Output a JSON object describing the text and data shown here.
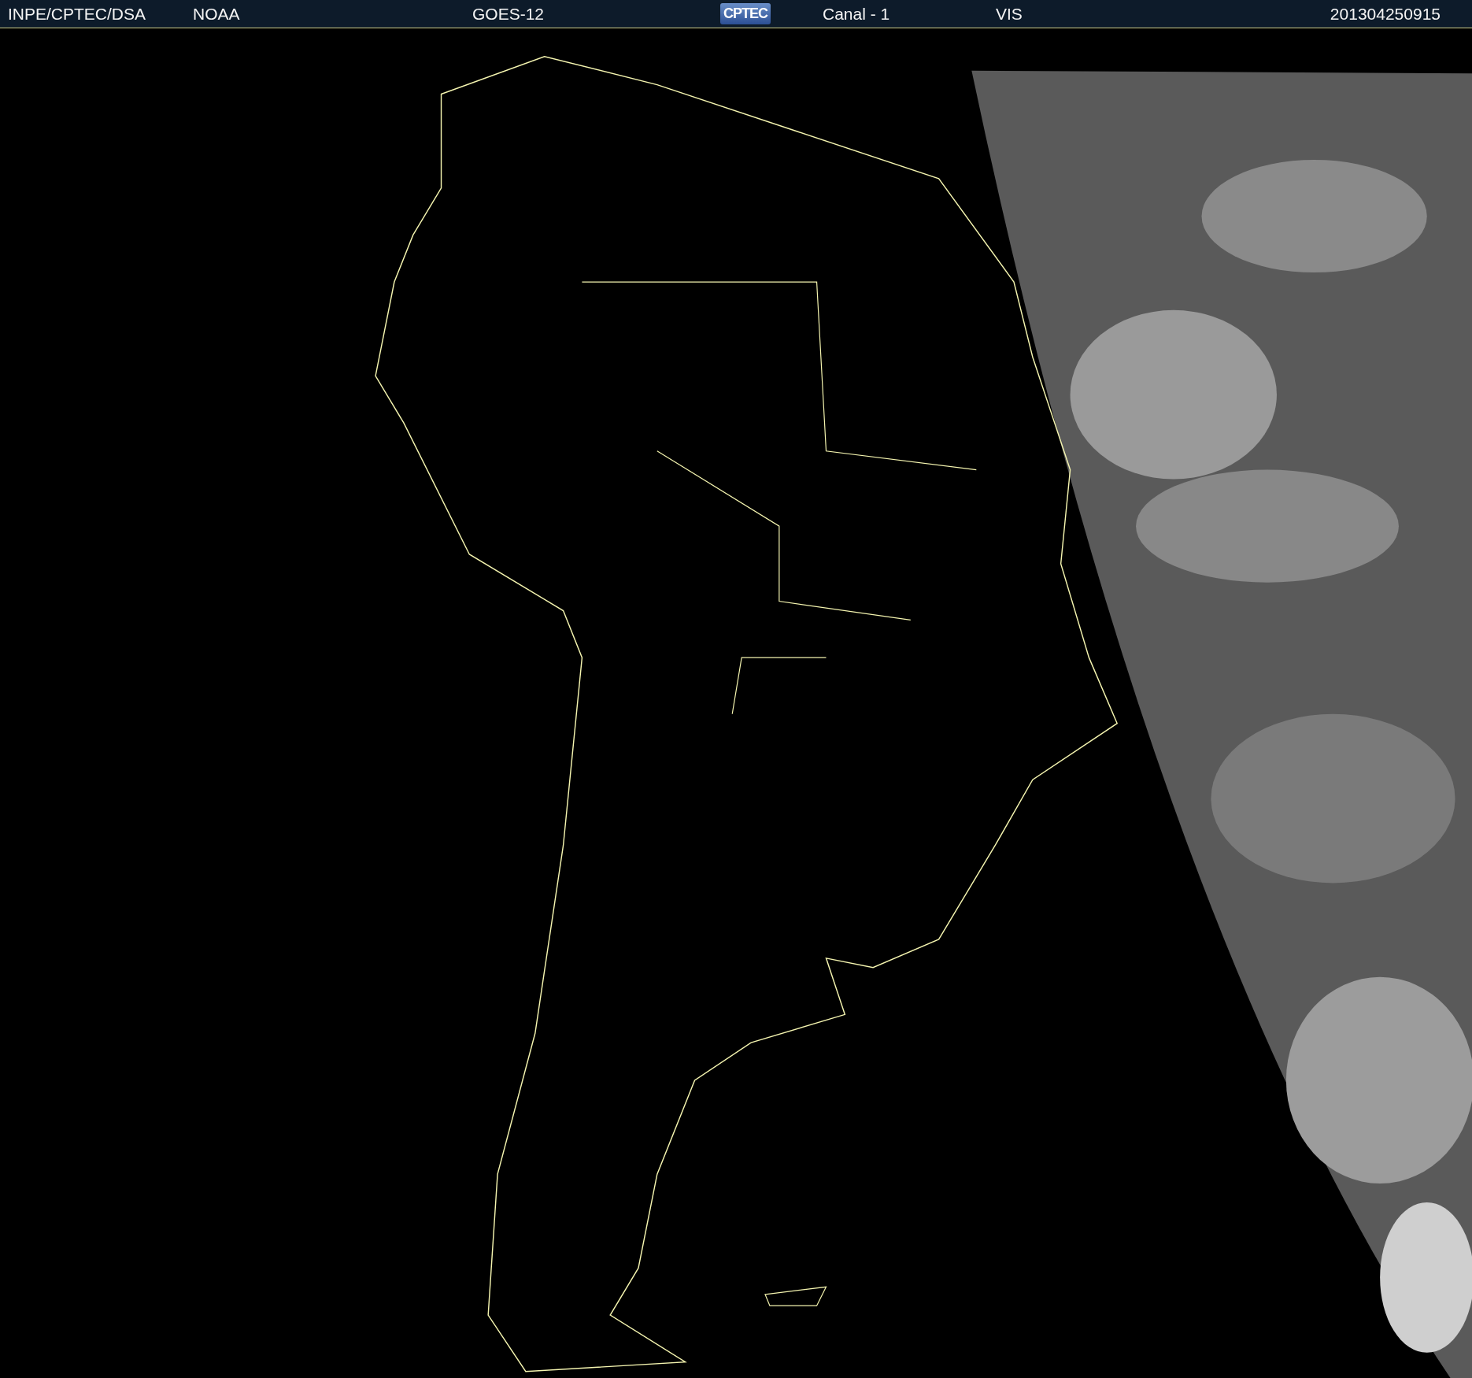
{
  "header": {
    "items": [
      {
        "kind": "text",
        "text": "INPE/CPTEC/DSA"
      },
      {
        "kind": "text",
        "text": "NOAA"
      },
      {
        "kind": "text",
        "text": "GOES-12"
      },
      {
        "kind": "logo",
        "text": "CPTEC"
      },
      {
        "kind": "text",
        "text": "Canal - 1"
      },
      {
        "kind": "text",
        "text": "VIS"
      },
      {
        "kind": "text",
        "text": "201304250915"
      }
    ]
  }
}
